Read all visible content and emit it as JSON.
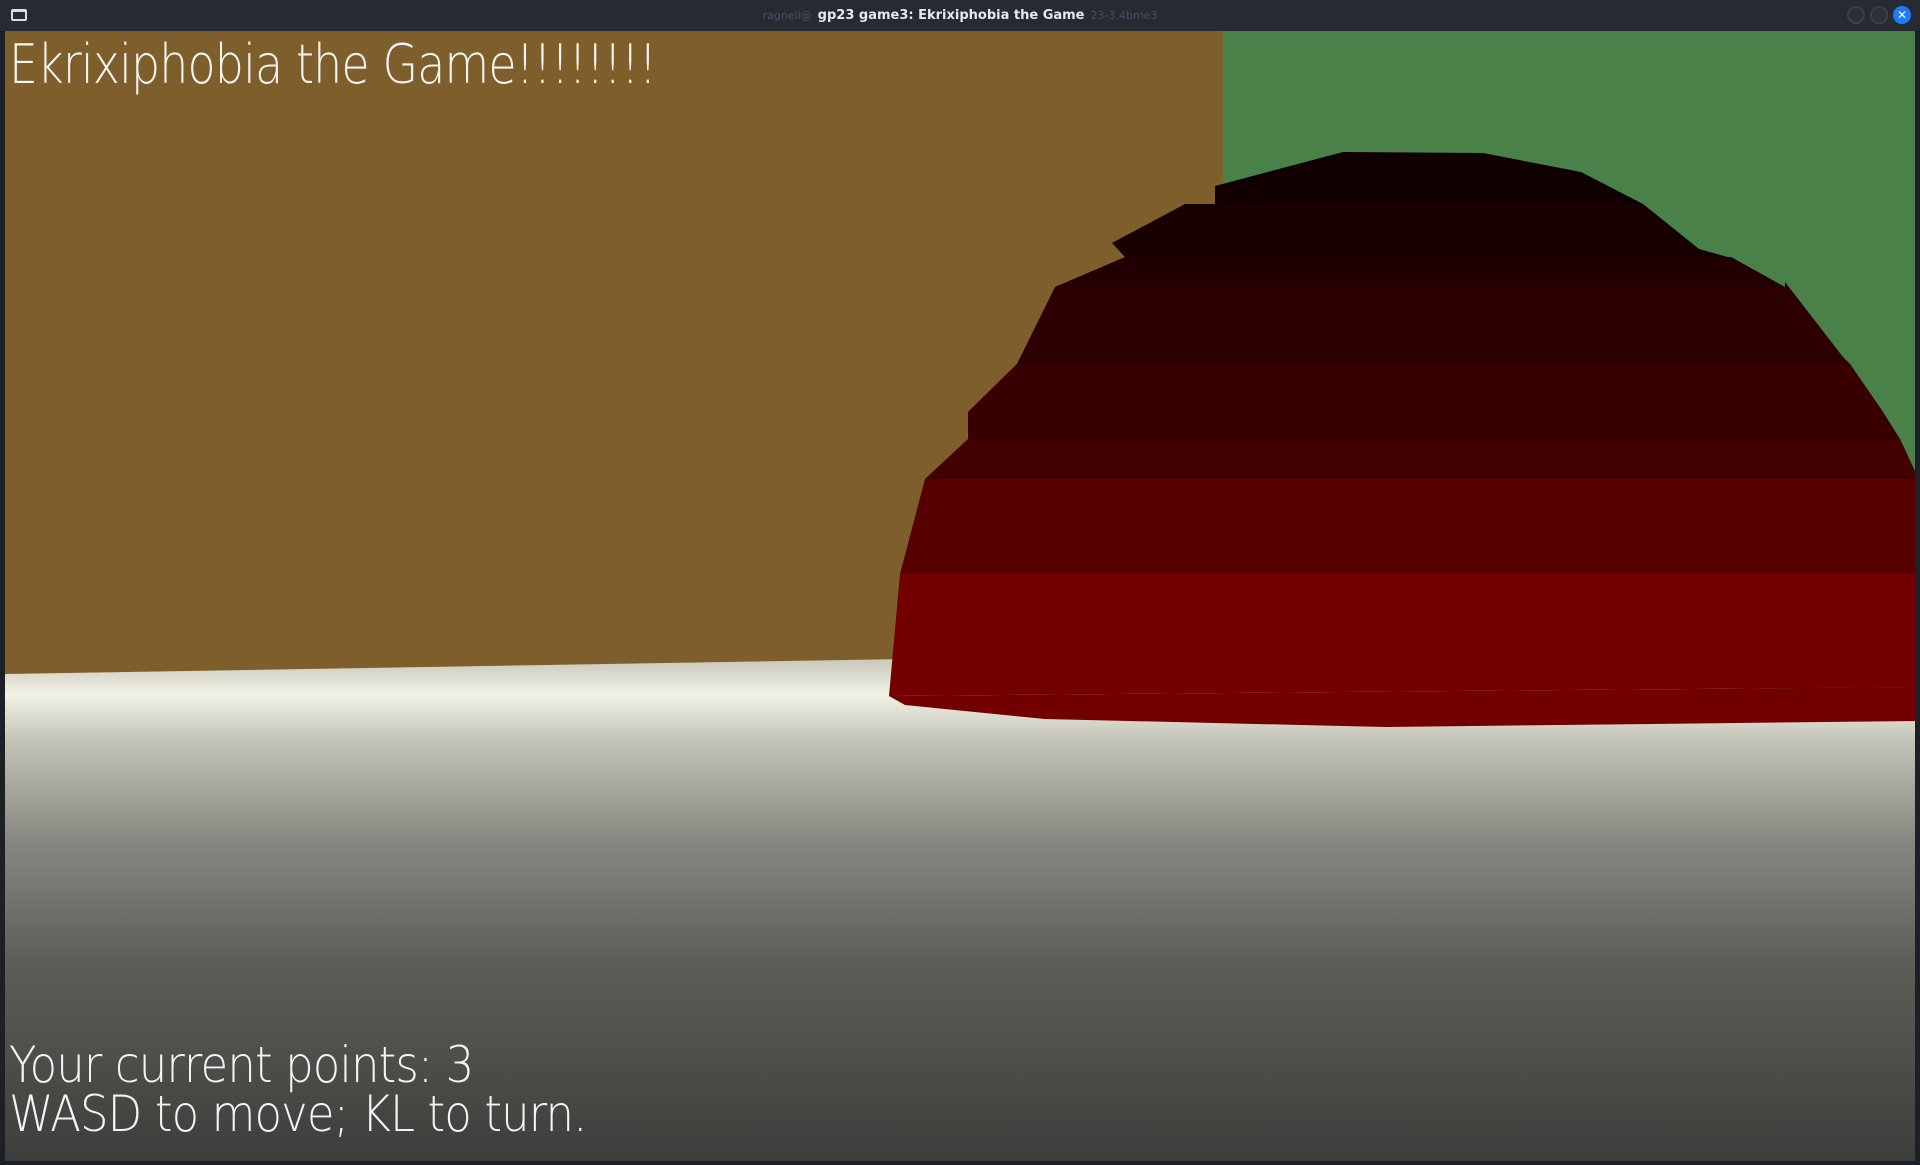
{
  "window": {
    "title": "gp23 game3: Ekrixiphobia the Game",
    "ghost_left": "ragnell@",
    "ghost_right": "23-3.4bme3"
  },
  "hud": {
    "title": "Ekrixiphobia the Game!!!!!!!!",
    "points_text": "Your current points: 3",
    "controls_text": "WASD to move; KL to turn."
  },
  "game": {
    "points": 3
  },
  "colors": {
    "wall_brown": "#7e5e2a",
    "wall_green": "#4a8148",
    "dome_red": "#720000",
    "floor_light": "#f3f2e6",
    "floor_dark": "#404040"
  }
}
